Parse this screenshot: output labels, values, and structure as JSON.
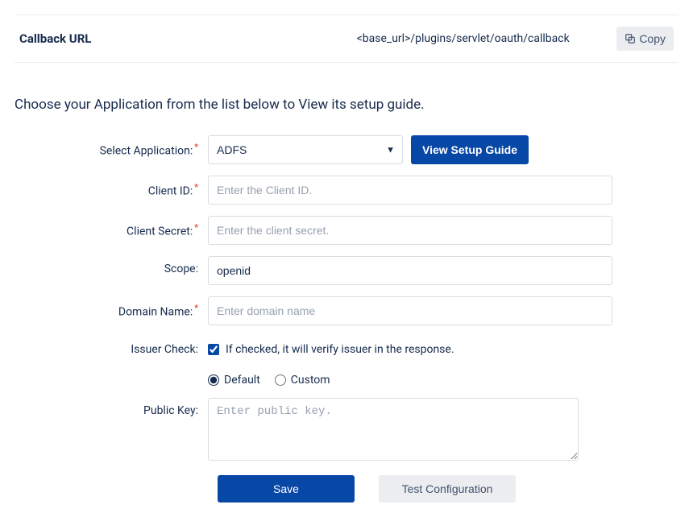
{
  "callback": {
    "label": "Callback URL",
    "value": "<base_url>/plugins/servlet/oauth/callback",
    "copy_label": "Copy"
  },
  "instructions": "Choose your Application from the list below to View its setup guide.",
  "form": {
    "select_application": {
      "label": "Select Application:",
      "value": "ADFS",
      "setup_guide_label": "View Setup Guide"
    },
    "client_id": {
      "label": "Client ID:",
      "placeholder": "Enter the Client ID.",
      "value": ""
    },
    "client_secret": {
      "label": "Client Secret:",
      "placeholder": "Enter the client secret.",
      "value": ""
    },
    "scope": {
      "label": "Scope:",
      "value": "openid"
    },
    "domain_name": {
      "label": "Domain Name:",
      "placeholder": "Enter domain name",
      "value": ""
    },
    "issuer_check": {
      "label": "Issuer Check:",
      "checkbox_label": "If checked, it will verify issuer in the response.",
      "checked": true
    },
    "radio": {
      "default_label": "Default",
      "custom_label": "Custom",
      "selected": "default"
    },
    "public_key": {
      "label": "Public Key:",
      "placeholder": "Enter public key.",
      "value": ""
    }
  },
  "buttons": {
    "save": "Save",
    "test": "Test Configuration"
  }
}
